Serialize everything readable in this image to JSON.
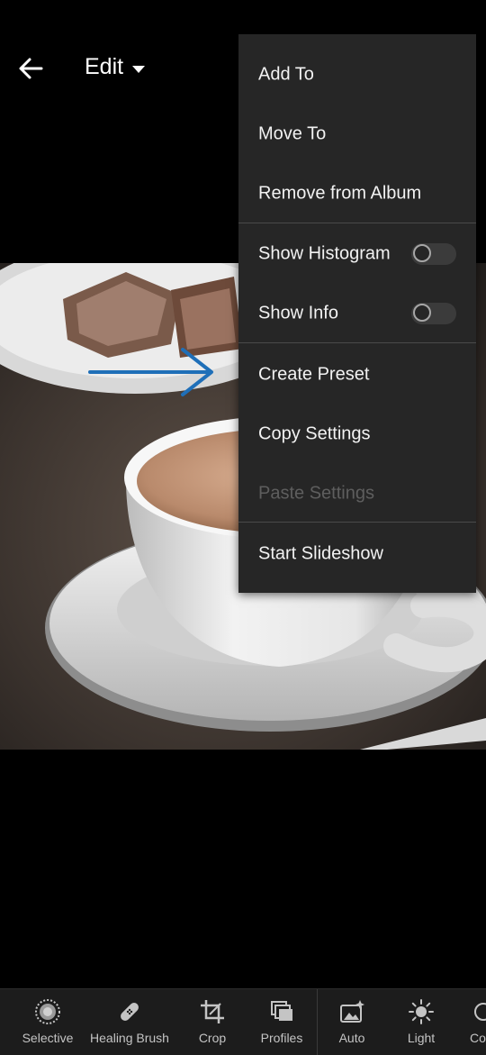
{
  "header": {
    "title": "Edit"
  },
  "menu": {
    "items": [
      {
        "label": "Add To"
      },
      {
        "label": "Move To"
      },
      {
        "label": "Remove from Album"
      },
      {
        "label": "Show Histogram",
        "toggle": "off"
      },
      {
        "label": "Show Info",
        "toggle": "off"
      },
      {
        "label": "Create Preset"
      },
      {
        "label": "Copy Settings"
      },
      {
        "label": "Paste Settings",
        "state": "disabled"
      },
      {
        "label": "Start Slideshow"
      }
    ]
  },
  "annotation": {
    "color": "#1f6fb8",
    "points_to": "Create Preset"
  },
  "toolbar": {
    "tools": [
      {
        "label": "Selective",
        "icon": "selective-icon"
      },
      {
        "label": "Healing Brush",
        "icon": "bandage-icon"
      },
      {
        "label": "Crop",
        "icon": "crop-icon"
      },
      {
        "label": "Profiles",
        "icon": "profiles-icon"
      },
      {
        "label": "Auto",
        "icon": "auto-icon"
      },
      {
        "label": "Light",
        "icon": "sun-icon"
      },
      {
        "label": "Co",
        "icon": "color-icon"
      }
    ]
  },
  "colors": {
    "menu_bg": "#262626",
    "toolbar_bg": "#1c1c1c",
    "disabled_text": "#5e5e5e"
  }
}
